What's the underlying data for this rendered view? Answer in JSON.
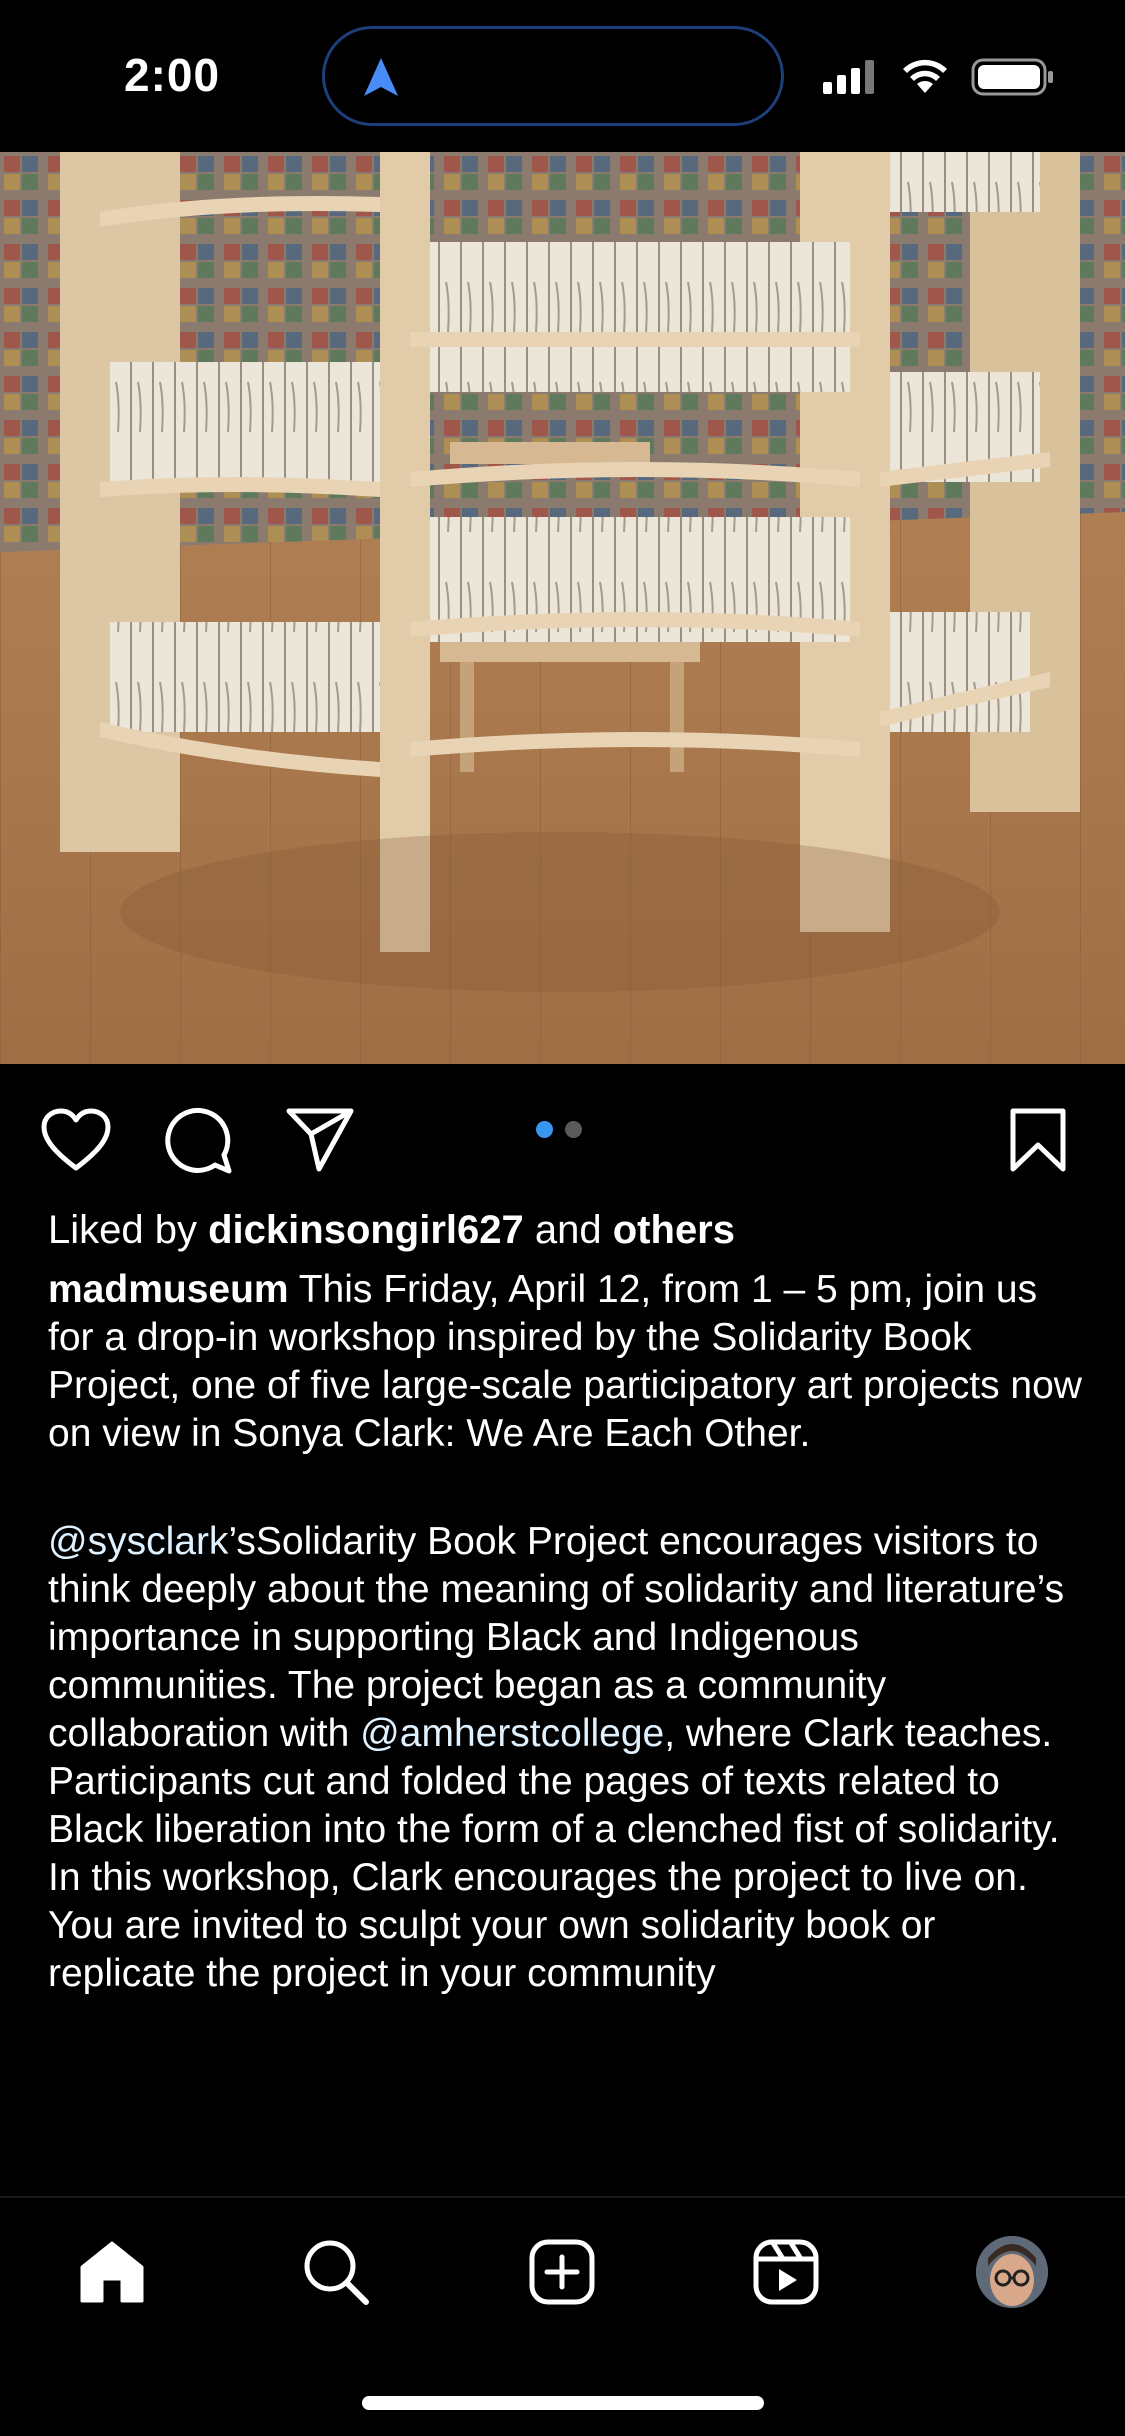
{
  "status_bar": {
    "time": "2:00"
  },
  "post": {
    "carousel": {
      "count": 2,
      "active_index": 0
    },
    "liked_by_prefix": "Liked by ",
    "liked_by_user": "dickinsongirl627",
    "liked_by_mid": " and ",
    "liked_by_others": "others",
    "author": "madmuseum",
    "caption_p1": " This Friday, April 12, from 1 – 5 pm, join us for a drop-in workshop inspired by the Solidarity Book Project, one of five large-scale participatory art projects now on view in  Sonya Clark: We Are Each Other.",
    "mention_1": "@sysclark",
    "caption_p2a": "’sSolidarity Book Project encourages visitors to think deeply about the meaning of solidarity and literature’s importance in supporting Black and Indigenous communities.  The project began as a community collaboration with ",
    "mention_2": "@amherstcollege",
    "caption_p2b": ", where Clark teaches. Participants cut and folded the pages of texts related to Black liberation into the form of a clenched fist of solidarity.  In this workshop, Clark encourages the project to live on. You are invited to sculpt your own solidarity book or replicate the project in your community"
  },
  "icons": {
    "like": "heart-icon",
    "comment": "comment-icon",
    "share": "send-icon",
    "save": "bookmark-icon",
    "home": "home-icon",
    "search": "search-icon",
    "create": "plus-square-icon",
    "reels": "reels-icon",
    "profile": "avatar"
  },
  "colors": {
    "background": "#000000",
    "carousel_active": "#3797f0",
    "mention": "#e0f1ff"
  }
}
